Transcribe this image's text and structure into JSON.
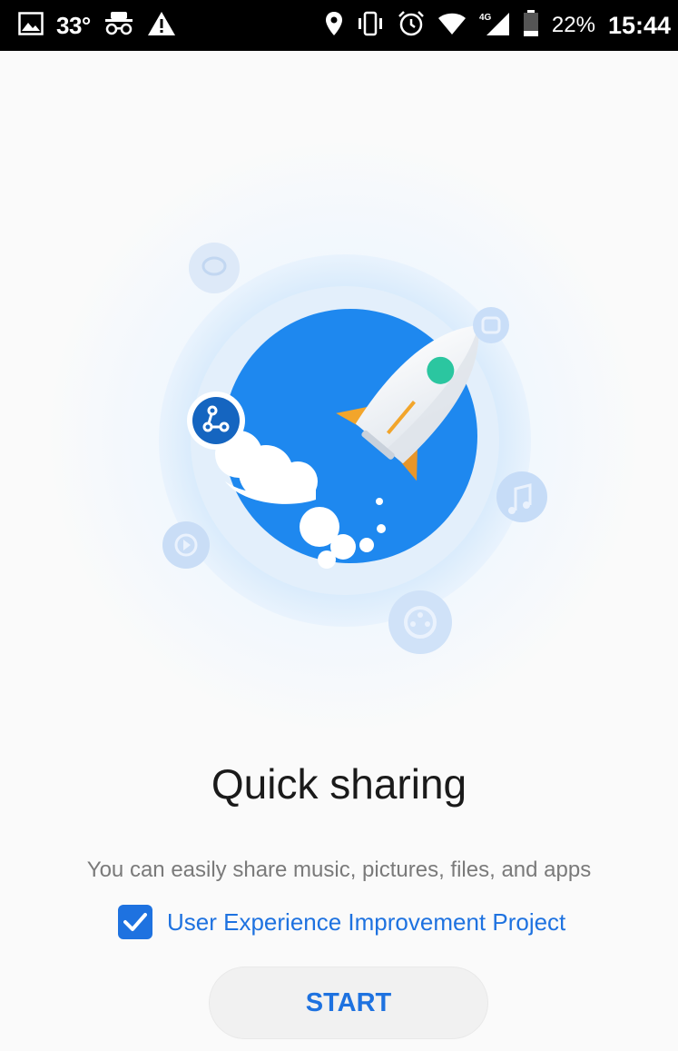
{
  "status_bar": {
    "temperature": "33°",
    "battery_percent": "22%",
    "time": "15:44",
    "network": "4G",
    "icons": [
      "image-icon",
      "incognito-icon",
      "warning-icon",
      "location-icon",
      "vibrate-icon",
      "alarm-icon",
      "wifi-icon",
      "signal-icon",
      "battery-icon"
    ]
  },
  "hero": {
    "illustration": "rocket-illustration",
    "orbit_icons": [
      "chat-icon",
      "app-icon",
      "share-icon",
      "music-icon",
      "video-icon",
      "film-reel-icon"
    ]
  },
  "content": {
    "title": "Quick sharing",
    "subtitle": "You can easily share music, pictures, files, and apps",
    "consent_label": "User Experience Improvement Project",
    "consent_checked": true
  },
  "actions": {
    "start_label": "START"
  },
  "colors": {
    "accent": "#1e72e0",
    "hero_blue": "#1e88ef",
    "rocket_window": "#2bc6a0",
    "rocket_fin": "#f2a52b",
    "background": "#fafafa"
  }
}
